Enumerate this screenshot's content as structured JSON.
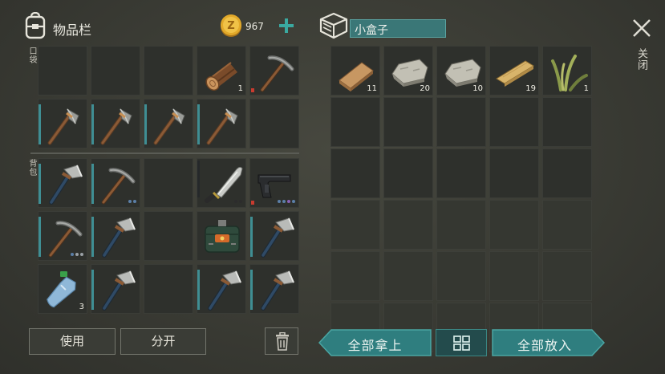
{
  "inventory": {
    "title": "物品栏",
    "coins": "967",
    "coin_symbol": "Z",
    "pocket_label": "口袋",
    "backpack_label": "背包",
    "pocket": [
      {
        "item": "empty"
      },
      {
        "item": "empty"
      },
      {
        "item": "empty"
      },
      {
        "item": "log-icon",
        "count": "1"
      },
      {
        "item": "pickaxe-icon",
        "durability": "low"
      },
      {
        "item": "stone-hatchet-icon",
        "durability": "full"
      },
      {
        "item": "stone-hatchet-icon",
        "durability": "full"
      },
      {
        "item": "stone-hatchet-icon",
        "durability": "full"
      },
      {
        "item": "stone-hatchet-icon",
        "durability": "full"
      },
      {
        "item": "empty"
      }
    ],
    "backpack": [
      {
        "item": "hatchet-icon",
        "durability": "full"
      },
      {
        "item": "pickaxe-icon",
        "durability": "full",
        "dots": [
          "#5b7fa8",
          "#5b7fa8"
        ]
      },
      {
        "item": "empty"
      },
      {
        "item": "machete-icon",
        "durability": "empty",
        "dots": [
          "#2c2c2c",
          "#2c2c2c"
        ]
      },
      {
        "item": "pistol-icon",
        "durability": "low",
        "dots": [
          "#5b7fa8",
          "#5b7fa8",
          "#8a62b8",
          "#5b7fa8"
        ]
      },
      {
        "item": "pickaxe-icon",
        "durability": "full",
        "dots": [
          "#5b7fa8",
          "#9aa0a6",
          "#9aa0a6"
        ]
      },
      {
        "item": "hatchet-icon",
        "durability": "full"
      },
      {
        "item": "empty"
      },
      {
        "item": "detonator-bag-icon"
      },
      {
        "item": "hatchet-icon",
        "durability": "full"
      },
      {
        "item": "water-bottle-icon",
        "count": "3"
      },
      {
        "item": "hatchet-icon",
        "durability": "full"
      },
      {
        "item": "empty"
      },
      {
        "item": "hatchet-icon",
        "durability": "full"
      },
      {
        "item": "hatchet-icon",
        "durability": "full"
      }
    ],
    "use_label": "使用",
    "split_label": "分开"
  },
  "container": {
    "name": "小盒子",
    "close_label": "关闭",
    "take_all_label": "全部拿上",
    "put_all_label": "全部放入",
    "items": [
      {
        "item": "wood-plank-icon",
        "count": "11"
      },
      {
        "item": "stone-icon",
        "count": "20"
      },
      {
        "item": "stone-icon",
        "count": "10"
      },
      {
        "item": "board-icon",
        "count": "19"
      },
      {
        "item": "plant-fiber-icon",
        "count": "1"
      }
    ]
  },
  "colors": {
    "accent_teal": "#2f7e7f",
    "durability_bar": "#3f8e93",
    "low_durability": "#c83b2f",
    "coin": "#e2a92a"
  }
}
